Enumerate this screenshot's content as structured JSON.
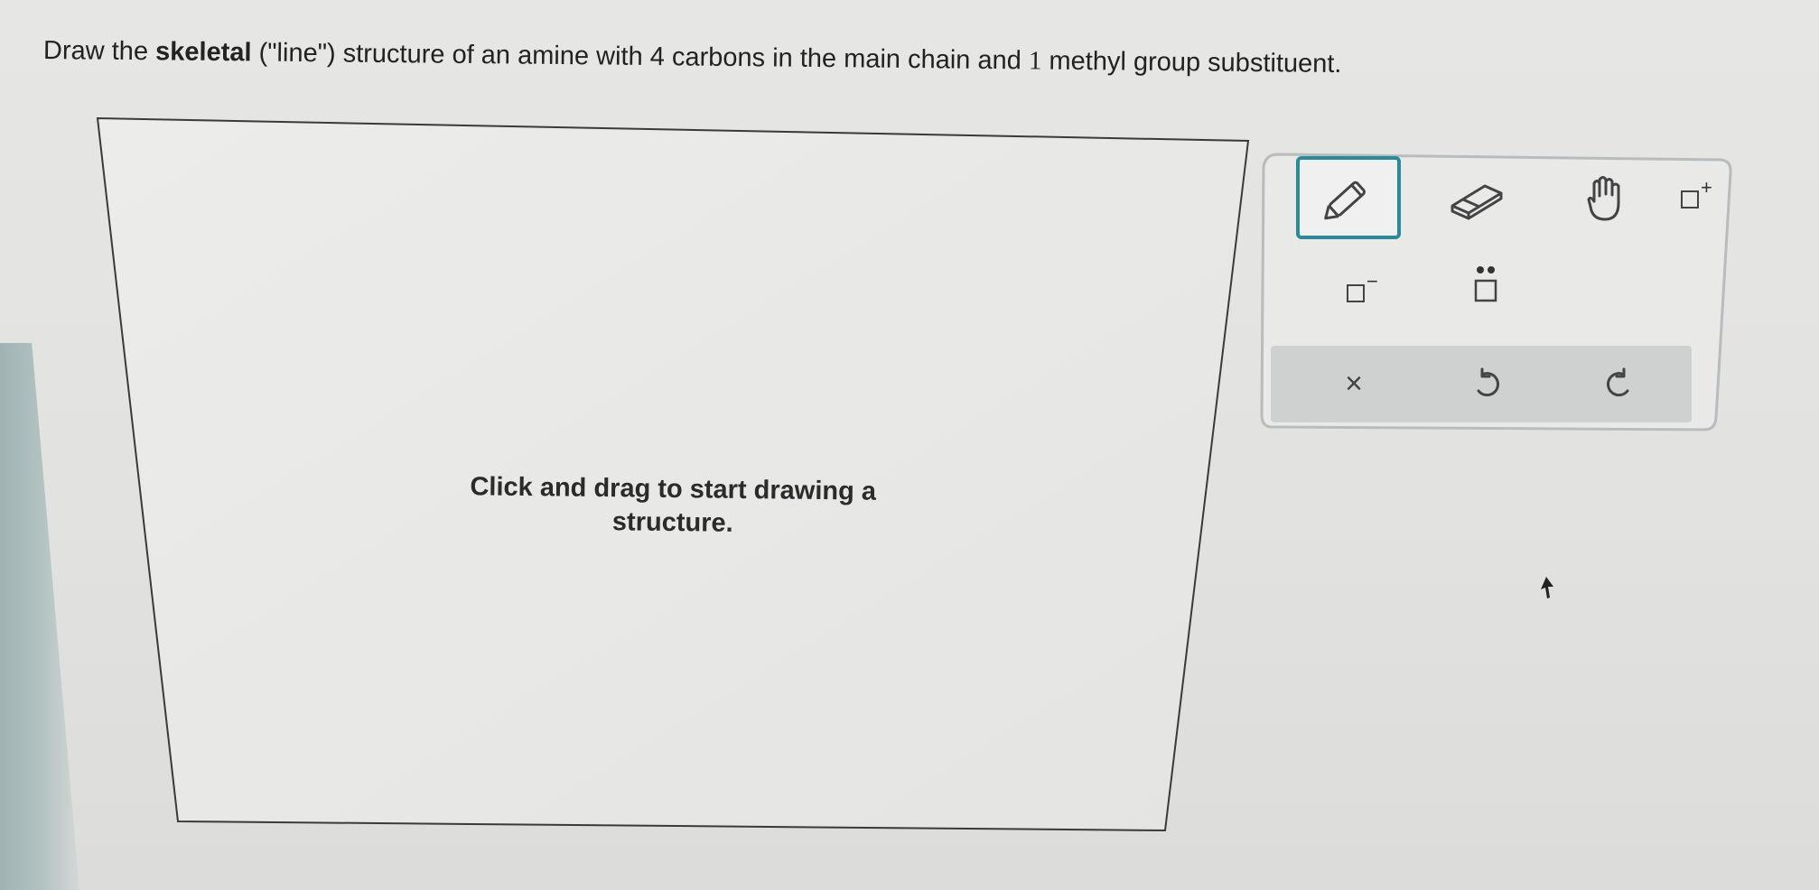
{
  "question": {
    "part1": "Draw the ",
    "bold": "skeletal",
    "part2": " (\"line\") structure of an amine with ",
    "num1": "4",
    "part3": " carbons in the main chain and ",
    "num2": "1",
    "part4": " methyl group substituent."
  },
  "canvas": {
    "hint_line1": "Click and drag to start drawing a",
    "hint_line2": "structure."
  },
  "toolbar": {
    "tools": [
      {
        "name": "pencil-tool",
        "icon": "pencil-icon",
        "selected": true
      },
      {
        "name": "eraser-tool",
        "icon": "eraser-icon",
        "selected": false
      },
      {
        "name": "hand-tool",
        "icon": "hand-icon",
        "selected": false
      },
      {
        "name": "positive-charge-tool",
        "icon": "positive-charge-icon",
        "sign": "+"
      },
      {
        "name": "negative-charge-tool",
        "icon": "negative-charge-icon",
        "sign": "−"
      },
      {
        "name": "lone-pair-tool",
        "icon": "lone-pair-icon"
      }
    ],
    "actions": {
      "clear": "×",
      "undo": "undo-icon",
      "redo": "redo-icon"
    }
  },
  "colors": {
    "accent": "#2a8a9a",
    "action_bar": "#cfd0d0"
  }
}
